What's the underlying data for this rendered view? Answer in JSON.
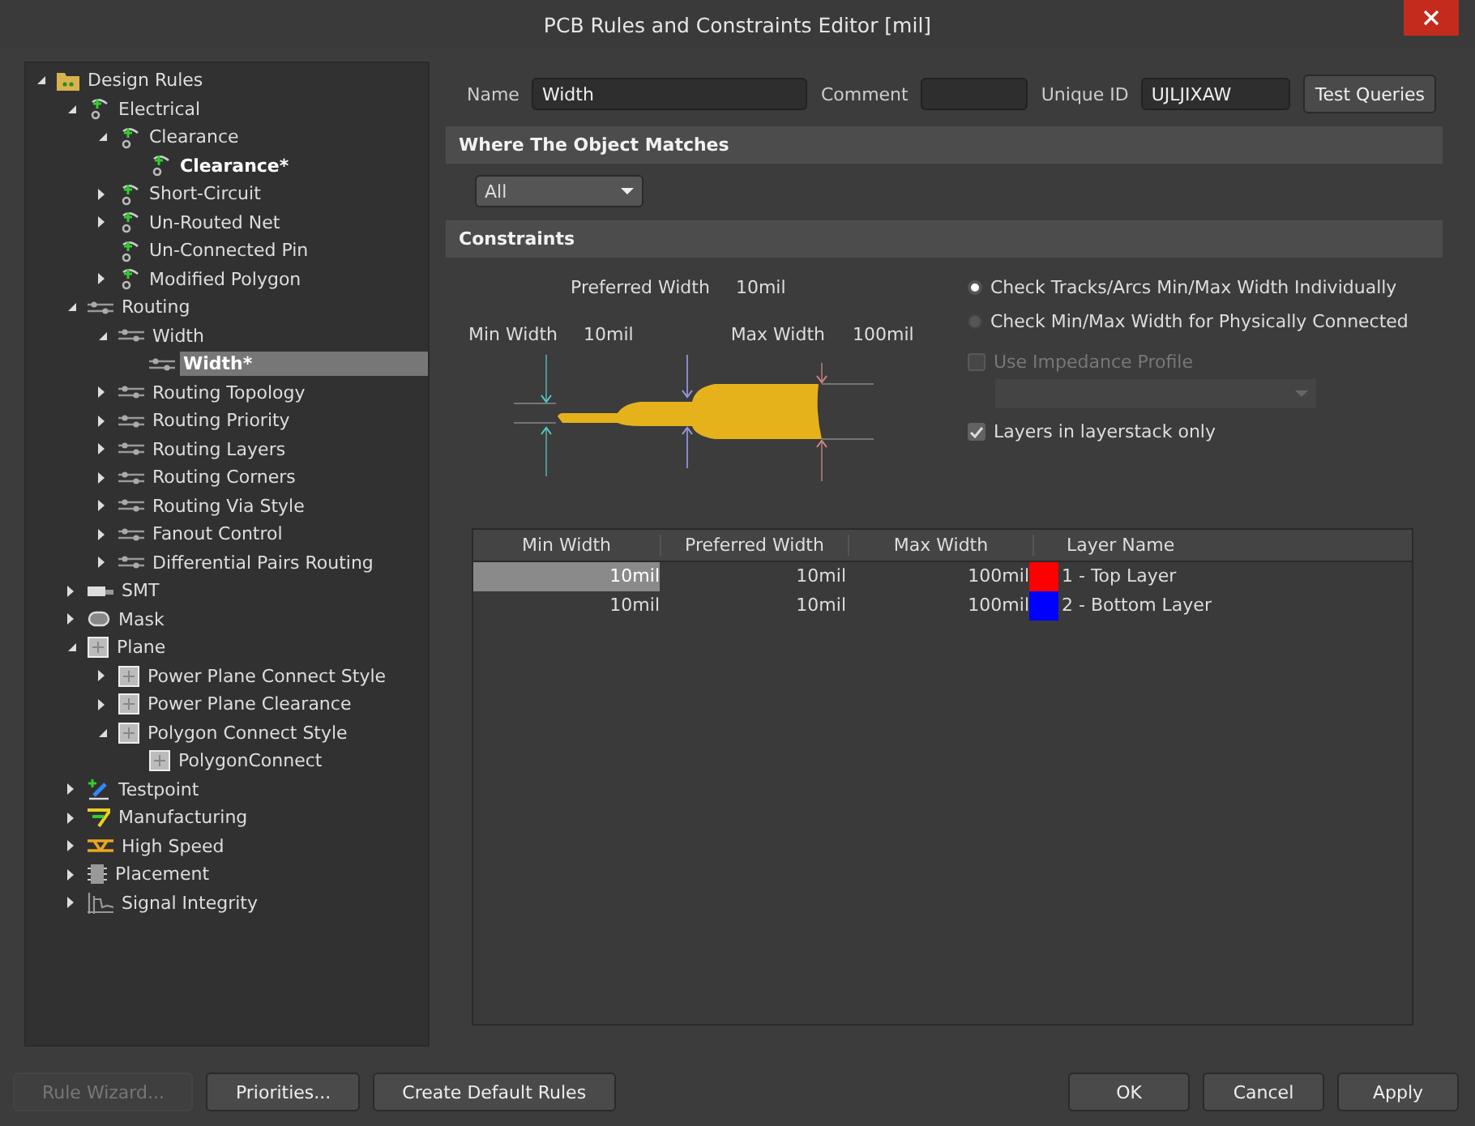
{
  "window": {
    "title": "PCB Rules and Constraints Editor [mil]"
  },
  "tree": [
    {
      "label": "Design Rules",
      "kind": "folder",
      "expandable": true,
      "expanded": true,
      "bold": false,
      "selected": false,
      "children": [
        {
          "label": "Electrical",
          "kind": "electrical",
          "expandable": true,
          "expanded": true,
          "bold": false,
          "selected": false,
          "children": [
            {
              "label": "Clearance",
              "kind": "electrical",
              "expandable": true,
              "expanded": true,
              "bold": false,
              "selected": false,
              "children": [
                {
                  "label": "Clearance*",
                  "kind": "electrical",
                  "expandable": false,
                  "bold": true,
                  "selected": false
                }
              ]
            },
            {
              "label": "Short-Circuit",
              "kind": "electrical",
              "expandable": true,
              "expanded": false,
              "bold": false,
              "selected": false
            },
            {
              "label": "Un-Routed Net",
              "kind": "electrical",
              "expandable": true,
              "expanded": false,
              "bold": false,
              "selected": false
            },
            {
              "label": "Un-Connected Pin",
              "kind": "electrical",
              "expandable": false,
              "bold": false,
              "selected": false
            },
            {
              "label": "Modified Polygon",
              "kind": "electrical",
              "expandable": true,
              "expanded": false,
              "bold": false,
              "selected": false
            }
          ]
        },
        {
          "label": "Routing",
          "kind": "routing",
          "expandable": true,
          "expanded": true,
          "bold": false,
          "selected": false,
          "children": [
            {
              "label": "Width",
              "kind": "routing",
              "expandable": true,
              "expanded": true,
              "bold": false,
              "selected": false,
              "children": [
                {
                  "label": "Width*",
                  "kind": "routing",
                  "expandable": false,
                  "bold": true,
                  "selected": true
                }
              ]
            },
            {
              "label": "Routing Topology",
              "kind": "routing",
              "expandable": true,
              "expanded": false,
              "bold": false,
              "selected": false
            },
            {
              "label": "Routing Priority",
              "kind": "routing",
              "expandable": true,
              "expanded": false,
              "bold": false,
              "selected": false
            },
            {
              "label": "Routing Layers",
              "kind": "routing",
              "expandable": true,
              "expanded": false,
              "bold": false,
              "selected": false
            },
            {
              "label": "Routing Corners",
              "kind": "routing",
              "expandable": true,
              "expanded": false,
              "bold": false,
              "selected": false
            },
            {
              "label": "Routing Via Style",
              "kind": "routing",
              "expandable": true,
              "expanded": false,
              "bold": false,
              "selected": false
            },
            {
              "label": "Fanout Control",
              "kind": "routing",
              "expandable": true,
              "expanded": false,
              "bold": false,
              "selected": false
            },
            {
              "label": "Differential Pairs Routing",
              "kind": "routing",
              "expandable": true,
              "expanded": false,
              "bold": false,
              "selected": false
            }
          ]
        },
        {
          "label": "SMT",
          "kind": "smt",
          "expandable": true,
          "expanded": false,
          "bold": false,
          "selected": false
        },
        {
          "label": "Mask",
          "kind": "mask",
          "expandable": true,
          "expanded": false,
          "bold": false,
          "selected": false
        },
        {
          "label": "Plane",
          "kind": "plane",
          "expandable": true,
          "expanded": true,
          "bold": false,
          "selected": false,
          "children": [
            {
              "label": "Power Plane Connect Style",
              "kind": "plane",
              "expandable": true,
              "expanded": false,
              "bold": false,
              "selected": false
            },
            {
              "label": "Power Plane Clearance",
              "kind": "plane",
              "expandable": true,
              "expanded": false,
              "bold": false,
              "selected": false
            },
            {
              "label": "Polygon Connect Style",
              "kind": "plane",
              "expandable": true,
              "expanded": true,
              "bold": false,
              "selected": false,
              "children": [
                {
                  "label": "PolygonConnect",
                  "kind": "plane",
                  "expandable": false,
                  "bold": false,
                  "selected": false
                }
              ]
            }
          ]
        },
        {
          "label": "Testpoint",
          "kind": "testpoint",
          "expandable": true,
          "expanded": false,
          "bold": false,
          "selected": false
        },
        {
          "label": "Manufacturing",
          "kind": "manufacturing",
          "expandable": true,
          "expanded": false,
          "bold": false,
          "selected": false
        },
        {
          "label": "High Speed",
          "kind": "highspeed",
          "expandable": true,
          "expanded": false,
          "bold": false,
          "selected": false
        },
        {
          "label": "Placement",
          "kind": "placement",
          "expandable": true,
          "expanded": false,
          "bold": false,
          "selected": false
        },
        {
          "label": "Signal Integrity",
          "kind": "signal",
          "expandable": true,
          "expanded": false,
          "bold": false,
          "selected": false
        }
      ]
    }
  ],
  "rule": {
    "name_label": "Name",
    "name": "Width",
    "comment_label": "Comment",
    "unique_id_label": "Unique ID",
    "unique_id": "UJLJIXAW",
    "test_button": "Test Queries"
  },
  "match": {
    "heading": "Where The Object Matches",
    "dropdown": "All"
  },
  "constraints": {
    "heading": "Constraints",
    "preferred_label": "Preferred Width",
    "preferred_value": "10mil",
    "min_label": "Min Width",
    "min_value": "10mil",
    "max_label": "Max Width",
    "max_value": "100mil",
    "radios": [
      {
        "label": "Check Tracks/Arcs Min/Max Width Individually",
        "selected": true
      },
      {
        "label": "Check Min/Max Width for Physically Connected",
        "selected": false
      }
    ],
    "impedance": {
      "label": "Use Impedance Profile",
      "checked": false,
      "disabled": true
    },
    "layerstack": {
      "label": "Layers in layerstack only",
      "checked": true,
      "disabled": false
    },
    "table": {
      "columns": [
        "Min Width",
        "Preferred Width",
        "Max Width",
        "Layer Name"
      ],
      "rows": [
        {
          "min": "10mil",
          "preferred": "10mil",
          "max": "100mil",
          "color": "#ff0000",
          "layer": "1 - Top Layer",
          "selected": true
        },
        {
          "min": "10mil",
          "preferred": "10mil",
          "max": "100mil",
          "color": "#0000ff",
          "layer": "2 - Bottom Layer",
          "selected": false
        }
      ]
    }
  },
  "left_buttons": [
    {
      "label": "Rule Wizard...",
      "disabled": true
    },
    {
      "label": "Priorities...",
      "disabled": false
    },
    {
      "label": "Create Default Rules",
      "disabled": false
    }
  ],
  "right_buttons": [
    {
      "label": "OK",
      "disabled": false
    },
    {
      "label": "Cancel",
      "disabled": false
    },
    {
      "label": "Apply",
      "disabled": false
    }
  ]
}
